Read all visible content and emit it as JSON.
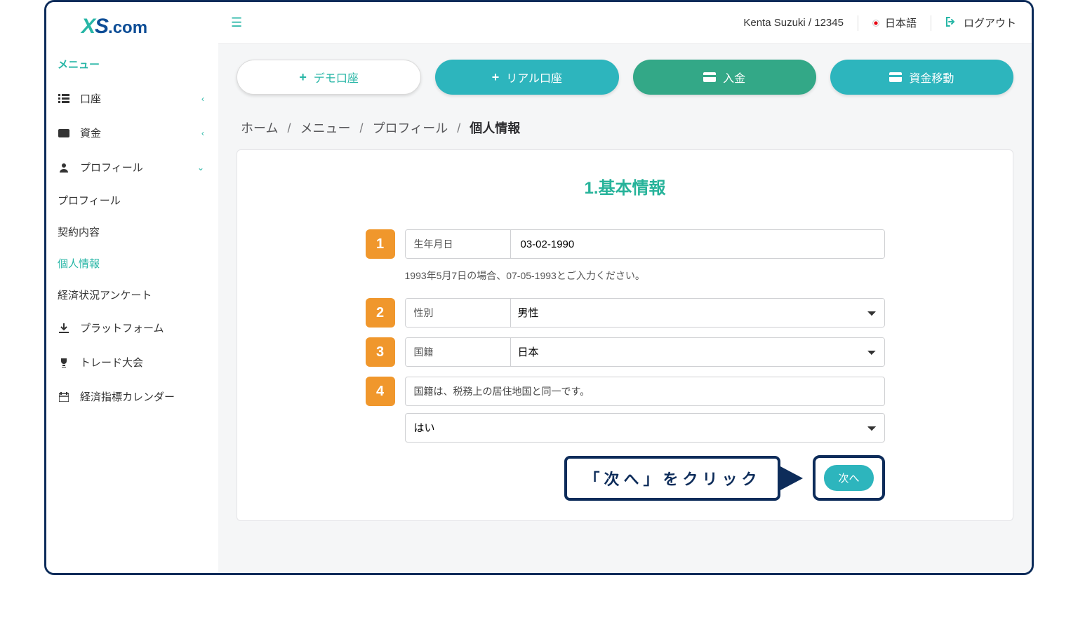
{
  "logo": {
    "x": "X",
    "s": "S",
    "dotcom": ".com"
  },
  "sidebar": {
    "title": "メニュー",
    "items": [
      {
        "label": "口座",
        "icon": "list-icon",
        "caret": "left"
      },
      {
        "label": "資金",
        "icon": "wallet-icon",
        "caret": "left"
      },
      {
        "label": "プロフィール",
        "icon": "user-icon",
        "caret": "down",
        "sub": [
          {
            "label": "プロフィール"
          },
          {
            "label": "契約内容"
          },
          {
            "label": "個人情報",
            "active": true
          },
          {
            "label": "経済状況アンケート"
          }
        ]
      },
      {
        "label": "プラットフォーム",
        "icon": "download-icon"
      },
      {
        "label": "トレード大会",
        "icon": "trophy-icon"
      },
      {
        "label": "経済指標カレンダー",
        "icon": "calendar-icon"
      }
    ]
  },
  "topbar": {
    "user": "Kenta Suzuki / 12345",
    "language": "日本語",
    "logout": "ログアウト"
  },
  "actions": {
    "demo": "デモ口座",
    "real": "リアル口座",
    "deposit": "入金",
    "transfer": "資金移動"
  },
  "breadcrumb": [
    "ホーム",
    "メニュー",
    "プロフィール",
    "個人情報"
  ],
  "form": {
    "heading": "1.基本情報",
    "rows": {
      "1": {
        "label": "生年月日",
        "value": "03-02-1990",
        "hint": "1993年5月7日の場合、07-05-1993とご入力ください。"
      },
      "2": {
        "label": "性別",
        "value": "男性"
      },
      "3": {
        "label": "国籍",
        "value": "日本"
      },
      "4": {
        "question": "国籍は、税務上の居住地国と同一です。",
        "answer": "はい"
      }
    }
  },
  "callout": "「次へ」をクリック",
  "next_button": "次へ"
}
